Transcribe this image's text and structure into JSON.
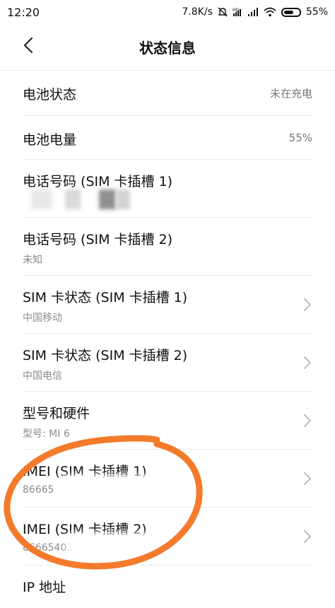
{
  "status_bar": {
    "time": "12:20",
    "speed": "7.8K/s",
    "battery": "55%",
    "icons": [
      "mute-icon",
      "hd-icon",
      "signal-icon",
      "signal-icon",
      "wifi-icon",
      "battery-icon"
    ]
  },
  "header": {
    "title": "状态信息",
    "back_icon": "chevron-left-icon"
  },
  "rows": [
    {
      "label": "电池状态",
      "value": "未在充电"
    },
    {
      "label": "电池电量",
      "value": "55%"
    },
    {
      "label": "电话号码 (SIM 卡插槽 1)",
      "sub": ""
    },
    {
      "label": "电话号码 (SIM 卡插槽 2)",
      "sub": "未知"
    },
    {
      "label": "SIM 卡状态 (SIM 卡插槽 1)",
      "sub": "中国移动"
    },
    {
      "label": "SIM 卡状态 (SIM 卡插槽 2)",
      "sub": "中国电信"
    },
    {
      "label": "型号和硬件",
      "sub": "型号: MI 6"
    },
    {
      "label": "IMEI (SIM 卡插槽 1)",
      "sub": "86665"
    },
    {
      "label": "IMEI (SIM 卡插槽 2)",
      "sub": "866654036"
    },
    {
      "label": "IP 地址"
    }
  ],
  "colors": {
    "annotation": "#f47a2c",
    "divider": "#ececec",
    "secondary_text": "#8c8c8c"
  }
}
